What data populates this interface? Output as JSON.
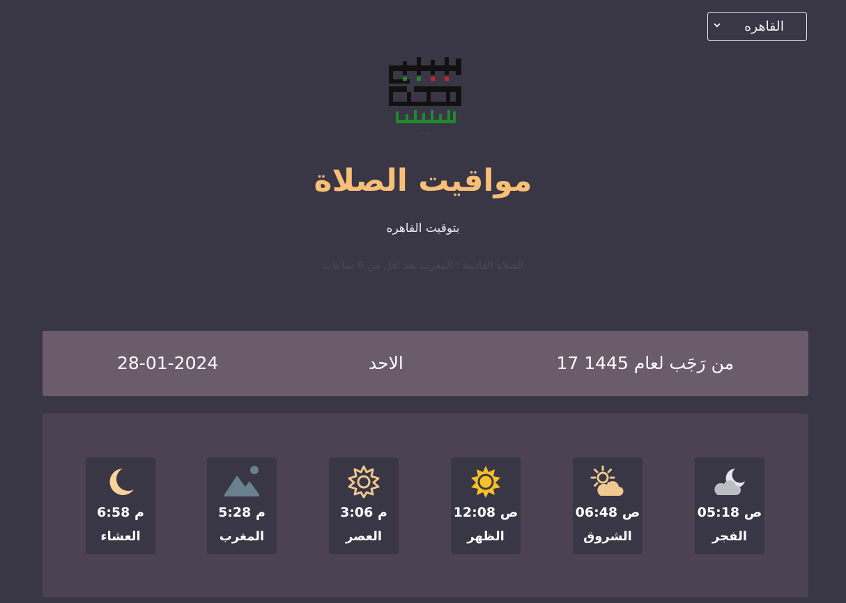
{
  "city_select": {
    "selected": "القاهره"
  },
  "logo": {
    "line1": "فلسطين",
    "line2": "قضيتي",
    "line3": "لاغالب إلا الله"
  },
  "header": {
    "title": "مواقيت الصلاة",
    "subtitle": "بتوقيت القاهره",
    "next_prayer": "الصلاة القادمة : المغرب بعد اقل من 0 ساعات"
  },
  "date_bar": {
    "hijri": "17 من رَجَب لعام 1445",
    "day": "الاحد",
    "gregorian": "28-01-2024"
  },
  "prayers": [
    {
      "name": "الفجر",
      "time": "05:18 ص",
      "icon": "moon-cloud-icon"
    },
    {
      "name": "الشروق",
      "time": "06:48 ص",
      "icon": "sun-cloud-icon"
    },
    {
      "name": "الظهر",
      "time": "12:08 ص",
      "icon": "sun-icon"
    },
    {
      "name": "العصر",
      "time": "3:06 م",
      "icon": "sun-outline-icon"
    },
    {
      "name": "المغرب",
      "time": "5:28 م",
      "icon": "mountain-icon"
    },
    {
      "name": "العشاء",
      "time": "6:58 م",
      "icon": "crescent-moon-icon"
    }
  ],
  "colors": {
    "background": "#393645",
    "title": "#f9bf76",
    "date_bar": "#6b5c6b",
    "panel": "#4d4252",
    "card": "#393645",
    "logo_green": "#1f8a2b",
    "logo_red": "#c0262d"
  }
}
